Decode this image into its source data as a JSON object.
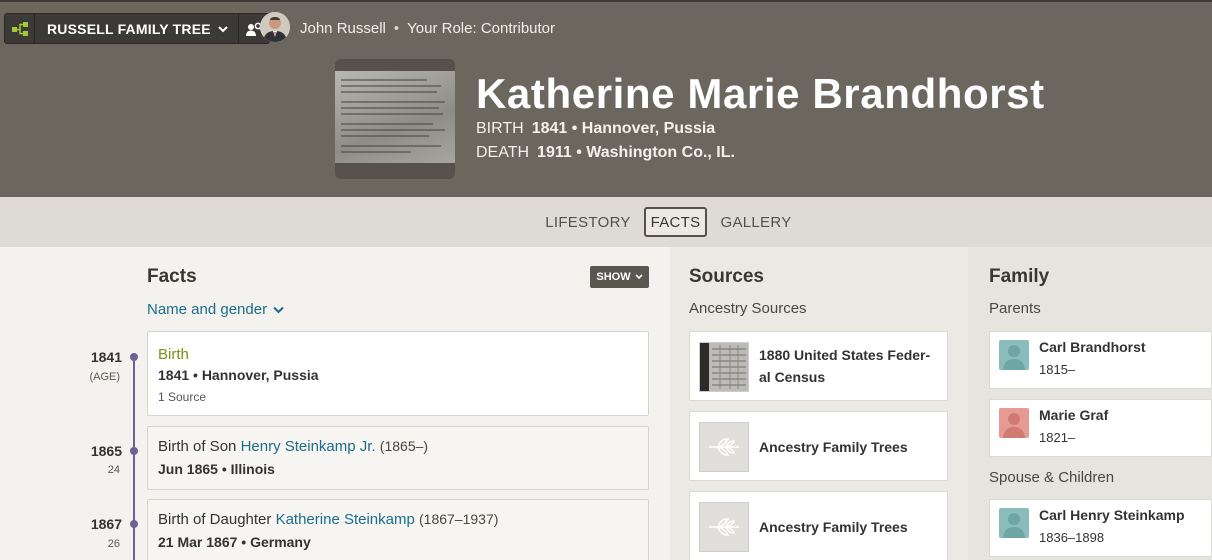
{
  "header": {
    "tree_name": "RUSSELL FAMILY TREE",
    "user_name": "John Russell",
    "separator": "•",
    "role": "Your Role: Contributor"
  },
  "person": {
    "name": "Katherine Marie Brandhorst",
    "birth_label": "BIRTH",
    "birth_value": "1841 • Hannover, Pussia",
    "death_label": "DEATH",
    "death_value": "1911 • Washington Co., IL."
  },
  "tabs": [
    {
      "label": "LIFESTORY",
      "active": false
    },
    {
      "label": "FACTS",
      "active": true
    },
    {
      "label": "GALLERY",
      "active": false
    }
  ],
  "facts": {
    "title": "Facts",
    "show_label": "SHOW",
    "name_gender_label": "Name and gender",
    "events": [
      {
        "year": "1841",
        "age": "(AGE)",
        "title": "Birth",
        "detail": "1841 • Hannover, Pussia",
        "sources": "1 Source"
      },
      {
        "year": "1865",
        "age": "24",
        "title_prefix": "Birth of Son",
        "title_link": "Henry Steinkamp Jr.",
        "title_suffix": "(1865–)",
        "detail": "Jun 1865 • Illinois"
      },
      {
        "year": "1867",
        "age": "26",
        "title_prefix": "Birth of Daughter",
        "title_link": "Katherine Steinkamp",
        "title_suffix": "(1867–1937)",
        "detail": "21 Mar 1867 • Germany"
      }
    ]
  },
  "sources": {
    "title": "Sources",
    "subtitle": "Ancestry Sources",
    "items": [
      {
        "title_line1": "1880 United States Feder-",
        "title_line2": "al Census"
      },
      {
        "title": "Ancestry Family Trees"
      },
      {
        "title": "Ancestry Family Trees"
      }
    ]
  },
  "family": {
    "title": "Family",
    "parents_label": "Parents",
    "parents": [
      {
        "name": "Carl Brandhorst",
        "dates": "1815–",
        "gender": "male"
      },
      {
        "name": "Marie Graf",
        "dates": "1821–",
        "gender": "female"
      }
    ],
    "spouse_label": "Spouse & Children",
    "spouses": [
      {
        "name": "Carl Henry Steinkamp",
        "dates": "1836–1898",
        "gender": "male"
      }
    ]
  },
  "colors": {
    "header_bg": "#6b665e",
    "tab_bar_bg": "#dedbd4",
    "link": "#1e6c8c",
    "birth_title": "#7c8f17",
    "timeline": "#6b6296",
    "male_avatar": "#8bbcbc",
    "female_avatar": "#e79a93"
  }
}
